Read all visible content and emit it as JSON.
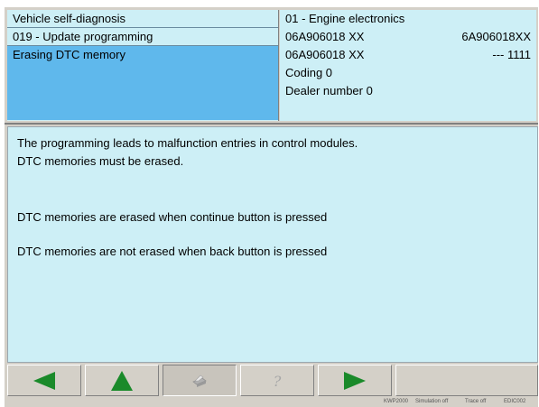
{
  "header": {
    "left": {
      "line1": "Vehicle self-diagnosis",
      "line2": "019 - Update programming",
      "line3": "Erasing DTC memory"
    },
    "right": {
      "line1": "01 - Engine electronics",
      "line2_left": "06A906018 XX",
      "line2_right": "6A906018XX",
      "line3_left": "06A906018 XX",
      "line3_right": "--- 1111",
      "line4": "Coding 0",
      "line5": "Dealer number 0"
    }
  },
  "messages": {
    "m1": "The programming leads to malfunction entries in control modules.",
    "m2": "DTC memories must be erased.",
    "m3": "DTC memories are erased when continue button is pressed",
    "m4": "DTC memories are not erased when back button is pressed"
  },
  "toolbar": {
    "back_icon": "arrow-left-icon",
    "up_icon": "arrow-up-icon",
    "print_icon": "printer-icon",
    "help_icon": "help-icon",
    "continue_icon": "arrow-right-icon",
    "arrow_color": "#1a8a2a"
  },
  "status": {
    "item1": "KWP2000",
    "item2": "Simulation off",
    "item3": "Trace off",
    "item4": "EDIC002"
  }
}
